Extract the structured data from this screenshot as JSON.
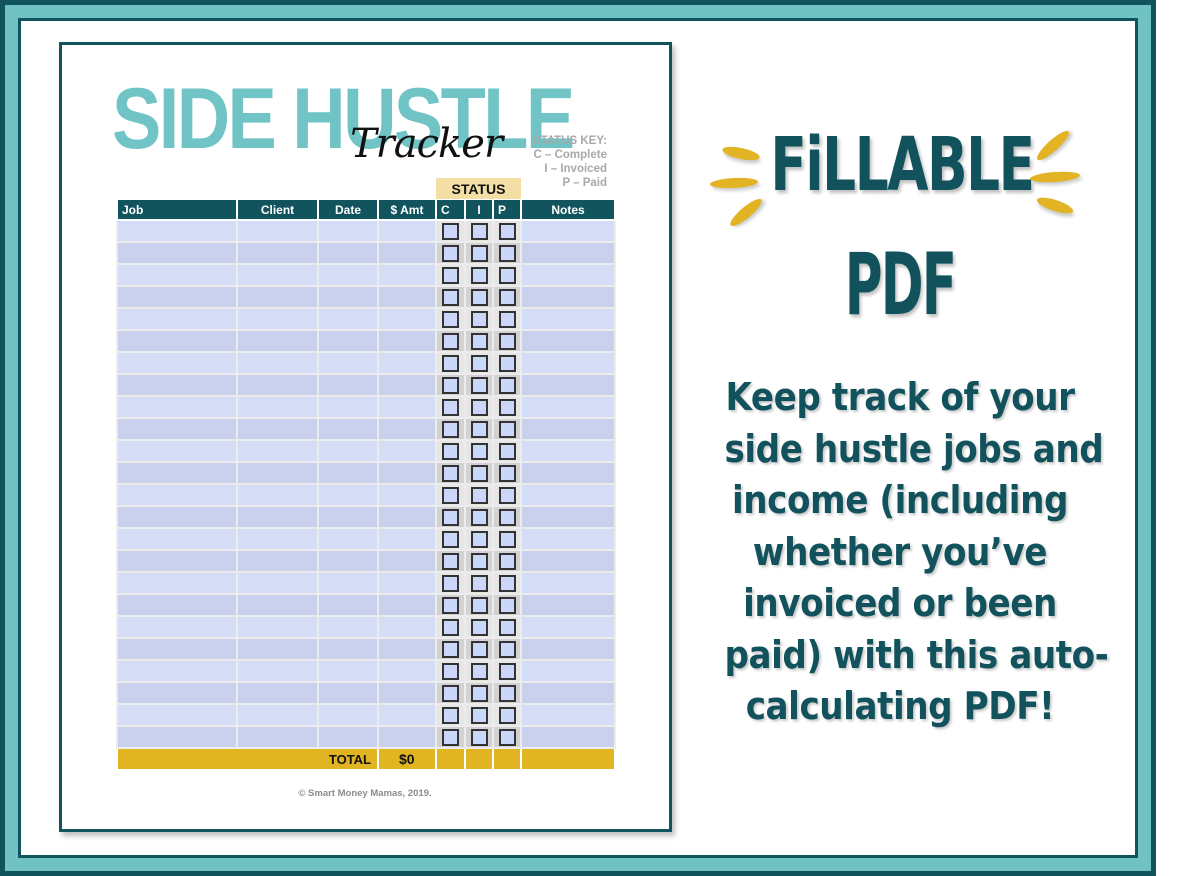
{
  "worksheet": {
    "title_main": "SIDE HUSTLE",
    "title_script": "Tracker",
    "status_key": {
      "heading": "STATUS KEY:",
      "items": [
        "C – Complete",
        "I – Invoiced",
        "P – Paid"
      ]
    },
    "status_group_label": "STATUS",
    "columns": [
      "Job",
      "Client",
      "Date",
      "$ Amt",
      "C",
      "I",
      "P",
      "Notes"
    ],
    "row_count": 24,
    "total_label": "TOTAL",
    "total_value": "$0",
    "copyright": "© Smart Money Mamas, 2019."
  },
  "promo": {
    "headline_1": "FiLLABLE",
    "headline_2": "PDF",
    "blurb_lines": [
      "Keep track of your",
      "side hustle jobs and",
      "income (including",
      "whether you’ve",
      "invoiced or been",
      "paid) with this auto-",
      "calculating PDF!"
    ]
  },
  "colors": {
    "teal_dark": "#12545e",
    "teal_light": "#70c2c3",
    "gold": "#e1b522",
    "status_tan": "#f3dfa6",
    "row_blue": "#d5dcf5"
  }
}
